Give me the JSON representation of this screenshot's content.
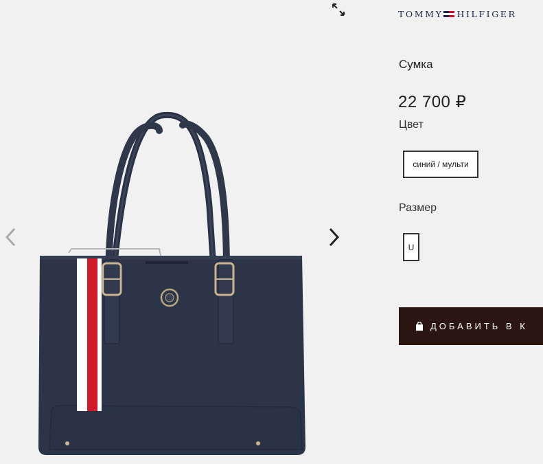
{
  "brand": {
    "left": "TOMMY",
    "right": "HILFIGER",
    "icon": "flag-icon"
  },
  "gallery": {
    "expand_icon": "expand-icon",
    "prev_icon": "chevron-left-icon",
    "next_icon": "chevron-right-icon",
    "image": "product-image-tote-bag"
  },
  "product": {
    "title": "Сумка",
    "price": "22 700 ₽",
    "color_label": "Цвет",
    "color_value": "синий / мульти",
    "size_label": "Размер",
    "size_value": "U",
    "add_to_cart": "ДОБАВИТЬ В К",
    "add_icon": "shopping-bag-icon"
  },
  "colors": {
    "background": "#f1f1f1",
    "brand_navy": "#1b2545",
    "brand_red": "#d0102c",
    "button_bg": "#2b1612",
    "bag_navy": "#2c3448"
  }
}
